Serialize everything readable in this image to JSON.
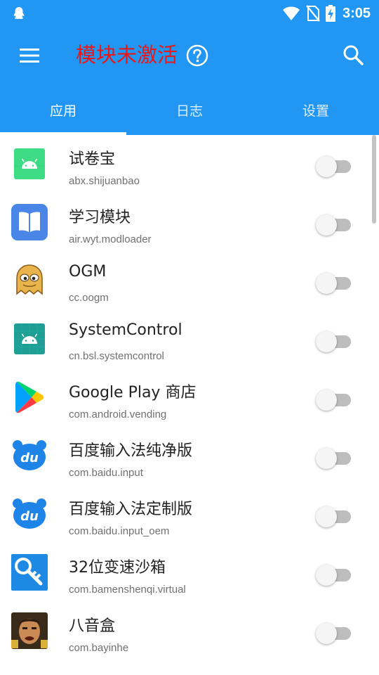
{
  "status_bar": {
    "time": "3:05",
    "icons": [
      "qq-icon",
      "wifi-icon",
      "no-sim-icon",
      "battery-charging-icon"
    ]
  },
  "app_bar": {
    "title": "模块未激活",
    "title_color": "#e81818",
    "background": "#2196f3"
  },
  "tabs": [
    {
      "label": "应用",
      "active": true
    },
    {
      "label": "日志",
      "active": false
    },
    {
      "label": "设置",
      "active": false
    }
  ],
  "apps": [
    {
      "name": "试卷宝",
      "package": "abx.shijuanbao",
      "icon": "android-green-icon",
      "enabled": false
    },
    {
      "name": "学习模块",
      "package": "air.wyt.modloader",
      "icon": "book-icon",
      "enabled": false
    },
    {
      "name": "OGM",
      "package": "cc.oogm",
      "icon": "ghost-icon",
      "enabled": false
    },
    {
      "name": "SystemControl",
      "package": "cn.bsl.systemcontrol",
      "icon": "android-teal-icon",
      "enabled": false
    },
    {
      "name": "Google Play 商店",
      "package": "com.android.vending",
      "icon": "google-play-icon",
      "enabled": false
    },
    {
      "name": "百度输入法纯净版",
      "package": "com.baidu.input",
      "icon": "baidu-du-icon",
      "enabled": false
    },
    {
      "name": "百度输入法定制版",
      "package": "com.baidu.input_oem",
      "icon": "baidu-du-icon",
      "enabled": false
    },
    {
      "name": "32位变速沙箱",
      "package": "com.bamenshenqi.virtual",
      "icon": "key-wrench-icon",
      "enabled": false
    },
    {
      "name": "八音盒",
      "package": "com.bayinhe",
      "icon": "face-photo-icon",
      "enabled": false
    }
  ]
}
